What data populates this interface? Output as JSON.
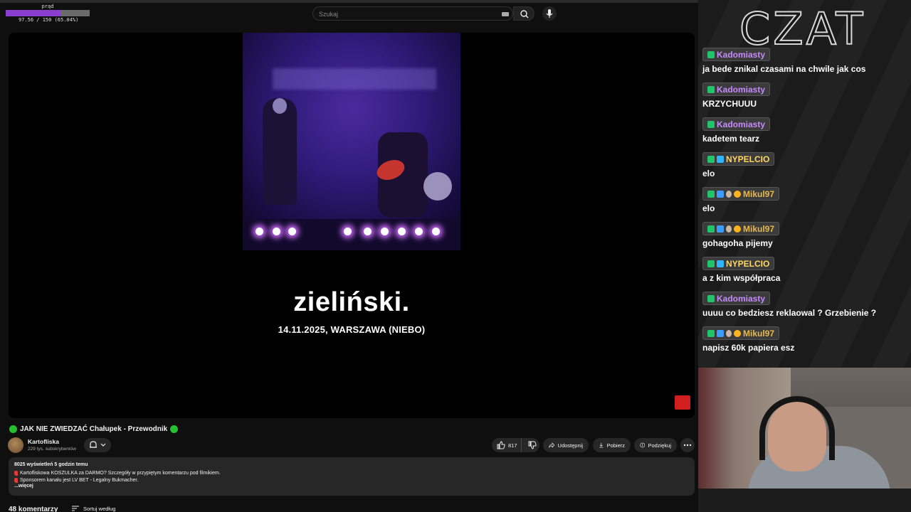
{
  "power": {
    "label": "prąd",
    "text": "97.56 / 150 (65.04%)",
    "fraction": 0.6504,
    "color": "#8a3fd0"
  },
  "search": {
    "placeholder": "Szukaj"
  },
  "player": {
    "overlay_title": "zieliński.",
    "overlay_subtitle": "14.11.2025, WARSZAWA (NIEBO)"
  },
  "video": {
    "title": "JAK NIE ZWIEDZAĆ Chałupek - Przewodnik",
    "channel_name": "Kartofliska",
    "channel_subs": "229 tys. subskrybentów",
    "likes": "817",
    "share": "Udostępnij",
    "download": "Pobierz",
    "thanks": "Podziękuj"
  },
  "description": {
    "meta": "8025 wyświetleń  5 godzin temu",
    "lines": [
      "Kartofliskowa KOSZULKA za DARMO? Szczegóły w przypiętym komentarzu pod filmikiem.",
      "Sponsorem kanału jest LV BET - Legalny Bukmacher."
    ],
    "more": "...więcej"
  },
  "comments": {
    "count": "48 komentarzy",
    "sort": "Sortuj według"
  },
  "chat": {
    "heading": "CZAT",
    "messages": [
      {
        "user": "Kadomiasty",
        "color": "#c58af9",
        "badges": [
          "k"
        ],
        "text": "ja bede znikal czasami na chwile jak cos"
      },
      {
        "user": "Kadomiasty",
        "color": "#c58af9",
        "badges": [
          "k"
        ],
        "text": "KRZYCHUUU"
      },
      {
        "user": "Kadomiasty",
        "color": "#c58af9",
        "badges": [
          "k"
        ],
        "text": "kadetem tearz"
      },
      {
        "user": "NYPELCIO",
        "color": "#ffd75e",
        "badges": [
          "k",
          "box"
        ],
        "text": "elo"
      },
      {
        "user": "Mikul97",
        "color": "#e8b84a",
        "badges": [
          "k",
          "prime",
          "skull",
          "one"
        ],
        "text": "elo"
      },
      {
        "user": "Mikul97",
        "color": "#e8b84a",
        "badges": [
          "k",
          "prime",
          "skull",
          "one"
        ],
        "text": "gohagoha pijemy"
      },
      {
        "user": "NYPELCIO",
        "color": "#ffd75e",
        "badges": [
          "k",
          "box"
        ],
        "text": "a z kim współpraca"
      },
      {
        "user": "Kadomiasty",
        "color": "#c58af9",
        "badges": [
          "k"
        ],
        "text": "uuuu co bedziesz reklaowal ? Grzebienie ?"
      },
      {
        "user": "Mikul97",
        "color": "#e8b84a",
        "badges": [
          "k",
          "prime",
          "skull",
          "one"
        ],
        "text": "napisz 60k papiera esz"
      }
    ]
  }
}
